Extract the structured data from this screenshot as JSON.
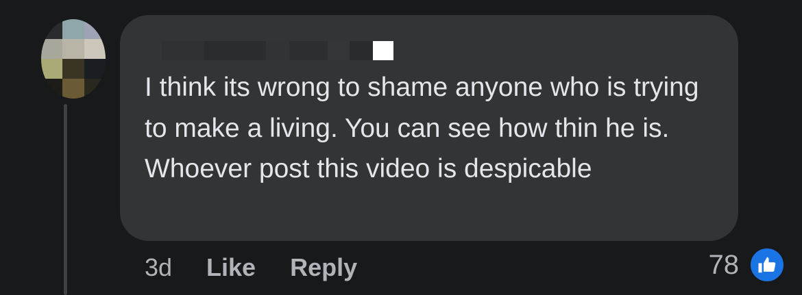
{
  "comment": {
    "text": "I think its wrong to shame anyone who is trying to make a living. You can see how thin he is. Whoever post this video is despicable",
    "author_redacted": true
  },
  "meta": {
    "time": "3d",
    "like_label": "Like",
    "reply_label": "Reply"
  },
  "reactions": {
    "count": "78",
    "icon": "thumbs-up-icon"
  },
  "colors": {
    "background": "#18191a",
    "bubble": "#333435",
    "text": "#e4e6eb",
    "meta_text": "#b0b3b8",
    "like_blue": "#1b74e4"
  }
}
